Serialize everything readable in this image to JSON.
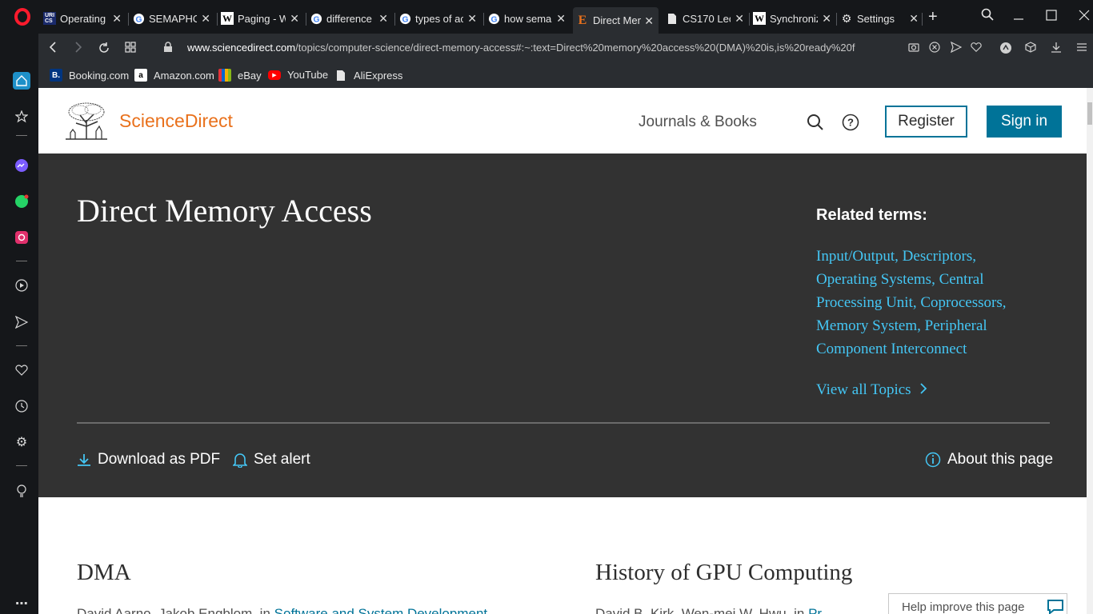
{
  "browser": {
    "tabs": [
      {
        "title": "Operating",
        "favicon": "URI CS"
      },
      {
        "title": "SEMAPHO",
        "favicon": "google-icon"
      },
      {
        "title": "Paging - W",
        "favicon": "wikipedia-icon"
      },
      {
        "title": "difference",
        "favicon": "google-icon"
      },
      {
        "title": "types of ac",
        "favicon": "google-icon"
      },
      {
        "title": "how sema",
        "favicon": "google-icon"
      },
      {
        "title": "Direct Mem",
        "favicon": "E"
      },
      {
        "title": "CS170 Lec",
        "favicon": "document-icon"
      },
      {
        "title": "Synchroniz",
        "favicon": "wikipedia-icon"
      },
      {
        "title": "Settings",
        "favicon": "gear-icon"
      }
    ],
    "url_domain": "www.sciencedirect.com",
    "url_rest": "/topics/computer-science/direct-memory-access#:~:text=Direct%20memory%20access%20(DMA)%20is,is%20ready%20f",
    "bookmarks": [
      {
        "label": "Booking.com",
        "icon": "B."
      },
      {
        "label": "Amazon.com",
        "icon": "a"
      },
      {
        "label": "eBay",
        "icon": "ebay-icon"
      },
      {
        "label": "YouTube",
        "icon": "youtube-icon"
      },
      {
        "label": "AliExpress",
        "icon": "document-icon"
      }
    ]
  },
  "site": {
    "brand": "ScienceDirect",
    "nav_link": "Journals & Books",
    "register": "Register",
    "signin": "Sign in",
    "brand_color": "#e9711c",
    "accent_color": "#007398"
  },
  "hero": {
    "title": "Direct Memory Access",
    "related_heading": "Related terms:",
    "related_terms": "Input/Output, Descriptors, Operating Systems, Central Processing Unit, Coprocessors, Memory System, Peripheral Component Interconnect",
    "view_all": "View all Topics",
    "download": "Download as PDF",
    "alert": "Set alert",
    "about": "About this page"
  },
  "sections": {
    "left_title": "DMA",
    "left_sub_author": "David Aarno, Jakob Engblom, in ",
    "left_sub_link": "Software and System Development",
    "right_title": "History of GPU Computing",
    "right_sub_author": "David B. Kirk, Wen-mei W. Hwu, in ",
    "right_sub_link": "Pr"
  },
  "help": {
    "label": "Help improve this page"
  }
}
